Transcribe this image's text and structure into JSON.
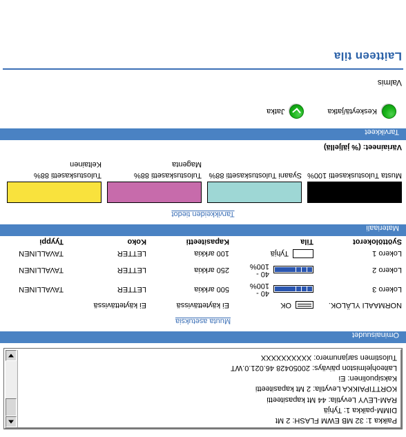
{
  "page": {
    "title": "Laitteen tila",
    "status_text": "Valmis"
  },
  "supplies_section": {
    "header": "Tarvikkeet",
    "buttons": [
      {
        "label": "Jatka",
        "icon": "green-resume-led"
      },
      {
        "label": "Keskeytä/jatka",
        "icon": "green-pause-resume-led"
      }
    ]
  },
  "toner": {
    "caption": "Väriaineet: (% jäljellä)",
    "items": [
      {
        "name": "Musta Tulostuskasetti",
        "percent": "100%",
        "label": "Musta Tulostuskasetti  100%",
        "color": "#000000",
        "fill": 100
      },
      {
        "name": "Syaani Tulostuskasetti",
        "percent": "88%",
        "label": "Syaani Tulostuskasetti  88%",
        "color": "#9ed7d5",
        "fill": 88
      },
      {
        "name": "Magenta",
        "percent": "88%",
        "label": "Tulostuskasetti  88%",
        "color": "#c76bab",
        "fill": 88
      },
      {
        "name": "Keltainen",
        "percent": "88%",
        "label": "Tulostuskasetti  88%",
        "color": "#f9e23d",
        "fill": 88
      }
    ],
    "details_link": "Tarvikkeiden tiedot",
    "section_header": "Materiaali"
  },
  "trays": {
    "columns": [
      "Syöttölokerot",
      "Tila",
      "Kapasiteetti",
      "Koko",
      "Tyyppi"
    ],
    "rows": [
      {
        "source": "Lokero 1",
        "status_text": "Tyhjä",
        "status_kind": "empty-box",
        "capacity": "100 arkkia",
        "size": "LETTER",
        "type": "TAVALLINEN"
      },
      {
        "source": "Lokero 2",
        "status_text": "40 - 100%",
        "status_kind": "gauge",
        "capacity": "250 arkkia",
        "size": "LETTER",
        "type": "TAVALLINEN"
      },
      {
        "source": "Lokero 3",
        "status_text": "40 - 100%",
        "status_kind": "gauge",
        "capacity": "500 arkkia",
        "size": "LETTER",
        "type": "TAVALLINEN"
      },
      {
        "source": "NORMAALI YLÄLOK.",
        "status_text": "OK",
        "status_kind": "out-bin",
        "capacity": "Ei käytettävissä",
        "size": "Ei käytettävissä",
        "type": ""
      }
    ],
    "gauge_range_low": "40 -",
    "gauge_range_high": "100%"
  },
  "properties": {
    "header": "Ominaisuudet",
    "settings_link": "Muuta asetuksia",
    "info_lines": [
      "Tulostimen sarjanumero: XXXXXXXXXX",
      "Laiteohjelmiston päiväys: 20050428 46.021.0.WT",
      "Kaksipuolinen: Ei",
      "KORTTIPAIKKA Levytila: 2 Mt kapasiteetti",
      "RAM-LEVY Levytila: 44 Mt kapasiteetti",
      "DIMM-paikka 1: Tyhjä",
      "Paikka 1: 32 MB EWM FLASH: 2 Mt"
    ]
  },
  "colors": {
    "section_bar": "#4a82c3",
    "title": "#2c62a8",
    "link": "#3b6fb6",
    "gauge_fill": "#2a56b0",
    "led_green": "#18b318"
  }
}
